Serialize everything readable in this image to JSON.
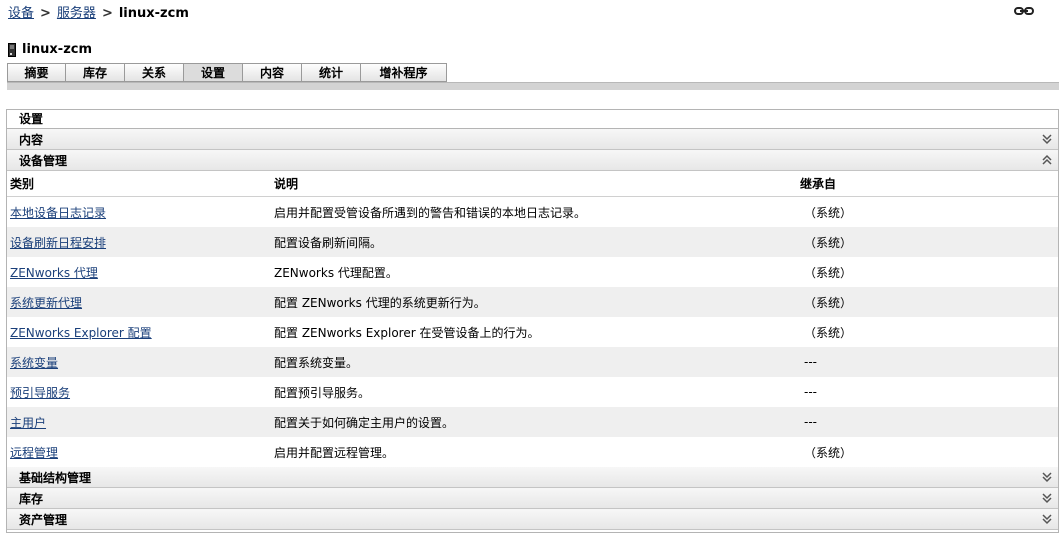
{
  "breadcrumb": {
    "item1": "设备",
    "item2": "服务器",
    "current": "linux-zcm",
    "separator": ">"
  },
  "device": {
    "name": "linux-zcm"
  },
  "tabs": [
    {
      "label": "摘要",
      "width": 58
    },
    {
      "label": "库存",
      "width": 59
    },
    {
      "label": "关系",
      "width": 59
    },
    {
      "label": "设置",
      "width": 59
    },
    {
      "label": "内容",
      "width": 59
    },
    {
      "label": "统计",
      "width": 59
    },
    {
      "label": "增补程序",
      "width": 87
    }
  ],
  "active_tab": "设置",
  "panel": {
    "title": "设置",
    "sections": {
      "content": "内容",
      "device_management": "设备管理",
      "infrastructure": "基础结构管理",
      "inventory": "库存",
      "asset": "资产管理"
    }
  },
  "table": {
    "headers": {
      "category": "类别",
      "description": "说明",
      "inherited": "继承自"
    },
    "rows": [
      {
        "category": "本地设备日志记录",
        "description": "启用并配置受管设备所遇到的警告和错误的本地日志记录。",
        "inherited": "（系统）"
      },
      {
        "category": "设备刷新日程安排",
        "description": "配置设备刷新间隔。",
        "inherited": "（系统）"
      },
      {
        "category": "ZENworks 代理",
        "description": "ZENworks 代理配置。",
        "inherited": "（系统）"
      },
      {
        "category": "系统更新代理",
        "description": "配置 ZENworks 代理的系统更新行为。",
        "inherited": "（系统）"
      },
      {
        "category": "ZENworks Explorer 配置",
        "description": "配置 ZENworks Explorer 在受管设备上的行为。",
        "inherited": "（系统）"
      },
      {
        "category": "系统变量",
        "description": "配置系统变量。",
        "inherited": "---"
      },
      {
        "category": "预引导服务",
        "description": "配置预引导服务。",
        "inherited": "---"
      },
      {
        "category": "主用户",
        "description": "配置关于如何确定主用户的设置。",
        "inherited": "---"
      },
      {
        "category": "远程管理",
        "description": "启用并配置远程管理。",
        "inherited": "（系统）"
      }
    ]
  }
}
